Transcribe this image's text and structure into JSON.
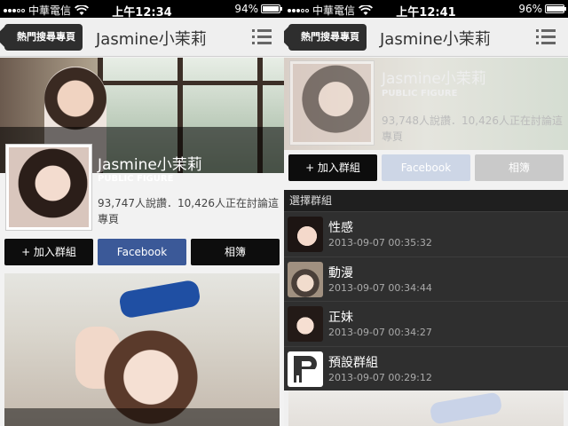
{
  "left": {
    "status": {
      "carrier": "中華電信",
      "time": "上午12:34",
      "battery": "94%",
      "battery_level": 0.94
    },
    "nav": {
      "back_label": "熱門搜尋專頁",
      "title": "Jasmine小茉莉"
    },
    "profile": {
      "name": "Jasmine小茉莉",
      "category": "PUBLIC FIGURE",
      "stats": "93,747人說讚．10,426人正在討論這專頁"
    },
    "buttons": {
      "join": "+ 加入群組",
      "facebook": "Facebook",
      "album": "相簿"
    }
  },
  "right": {
    "status": {
      "carrier": "中華電信",
      "time": "上午12:41",
      "battery": "96%",
      "battery_level": 0.96
    },
    "nav": {
      "back_label": "熱門搜尋專頁",
      "title": "Jasmine小茉莉"
    },
    "profile": {
      "name": "Jasmine小茉莉",
      "category": "PUBLIC FIGURE",
      "stats": "93,748人說讚．10,426人正在討論這專頁"
    },
    "buttons": {
      "join": "+ 加入群組",
      "facebook": "Facebook",
      "album": "相簿"
    },
    "panel": {
      "header": "選擇群組",
      "groups": [
        {
          "name": "性感",
          "date": "2013-09-07 00:35:32"
        },
        {
          "name": "動漫",
          "date": "2013-09-07 00:34:44"
        },
        {
          "name": "正妹",
          "date": "2013-09-07 00:34:27"
        },
        {
          "name": "預設群組",
          "date": "2013-09-07 00:29:12"
        }
      ]
    }
  }
}
